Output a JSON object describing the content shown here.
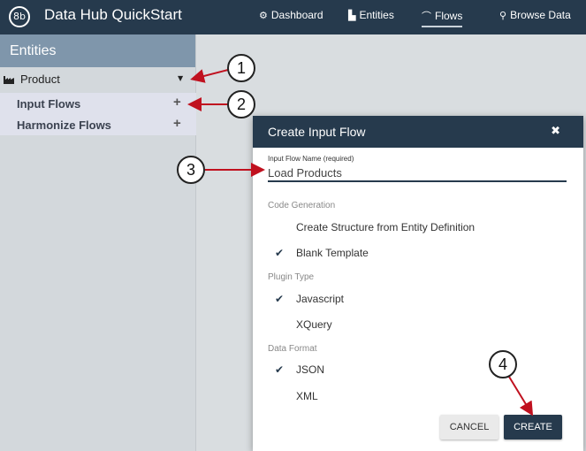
{
  "header": {
    "logo_text": "8b",
    "app_title": "Data Hub QuickStart",
    "nav": [
      {
        "label": "Dashboard",
        "icon": "dashboard-icon",
        "glyph": "⚙"
      },
      {
        "label": "Entities",
        "icon": "entities-icon",
        "glyph": "▙"
      },
      {
        "label": "Flows",
        "icon": "flows-icon",
        "glyph": "⌒"
      },
      {
        "label": "Browse Data",
        "icon": "search-icon",
        "glyph": "⚲"
      }
    ],
    "active_nav": "Flows"
  },
  "sidebar": {
    "title": "Entities",
    "entity": {
      "label": "Product",
      "caret": "▼"
    },
    "flows": [
      {
        "label": "Input Flows",
        "action": "+"
      },
      {
        "label": "Harmonize Flows",
        "action": "+"
      }
    ]
  },
  "dialog": {
    "title": "Create Input Flow",
    "close": "✖",
    "name_label": "Input Flow Name (required)",
    "name_value": "Load Products",
    "sections": [
      {
        "label": "Code Generation",
        "options": [
          {
            "label": "Create Structure from Entity Definition",
            "checked": false
          },
          {
            "label": "Blank Template",
            "checked": true
          }
        ]
      },
      {
        "label": "Plugin Type",
        "options": [
          {
            "label": "Javascript",
            "checked": true
          },
          {
            "label": "XQuery",
            "checked": false
          }
        ]
      },
      {
        "label": "Data Format",
        "options": [
          {
            "label": "JSON",
            "checked": true
          },
          {
            "label": "XML",
            "checked": false
          }
        ]
      }
    ],
    "cancel_label": "CANCEL",
    "create_label": "CREATE"
  },
  "callouts": [
    "1",
    "2",
    "3",
    "4"
  ],
  "colors": {
    "topbar": "#263a4d",
    "sidebar_header": "#7f96ab",
    "arrow": "#c0111f"
  }
}
